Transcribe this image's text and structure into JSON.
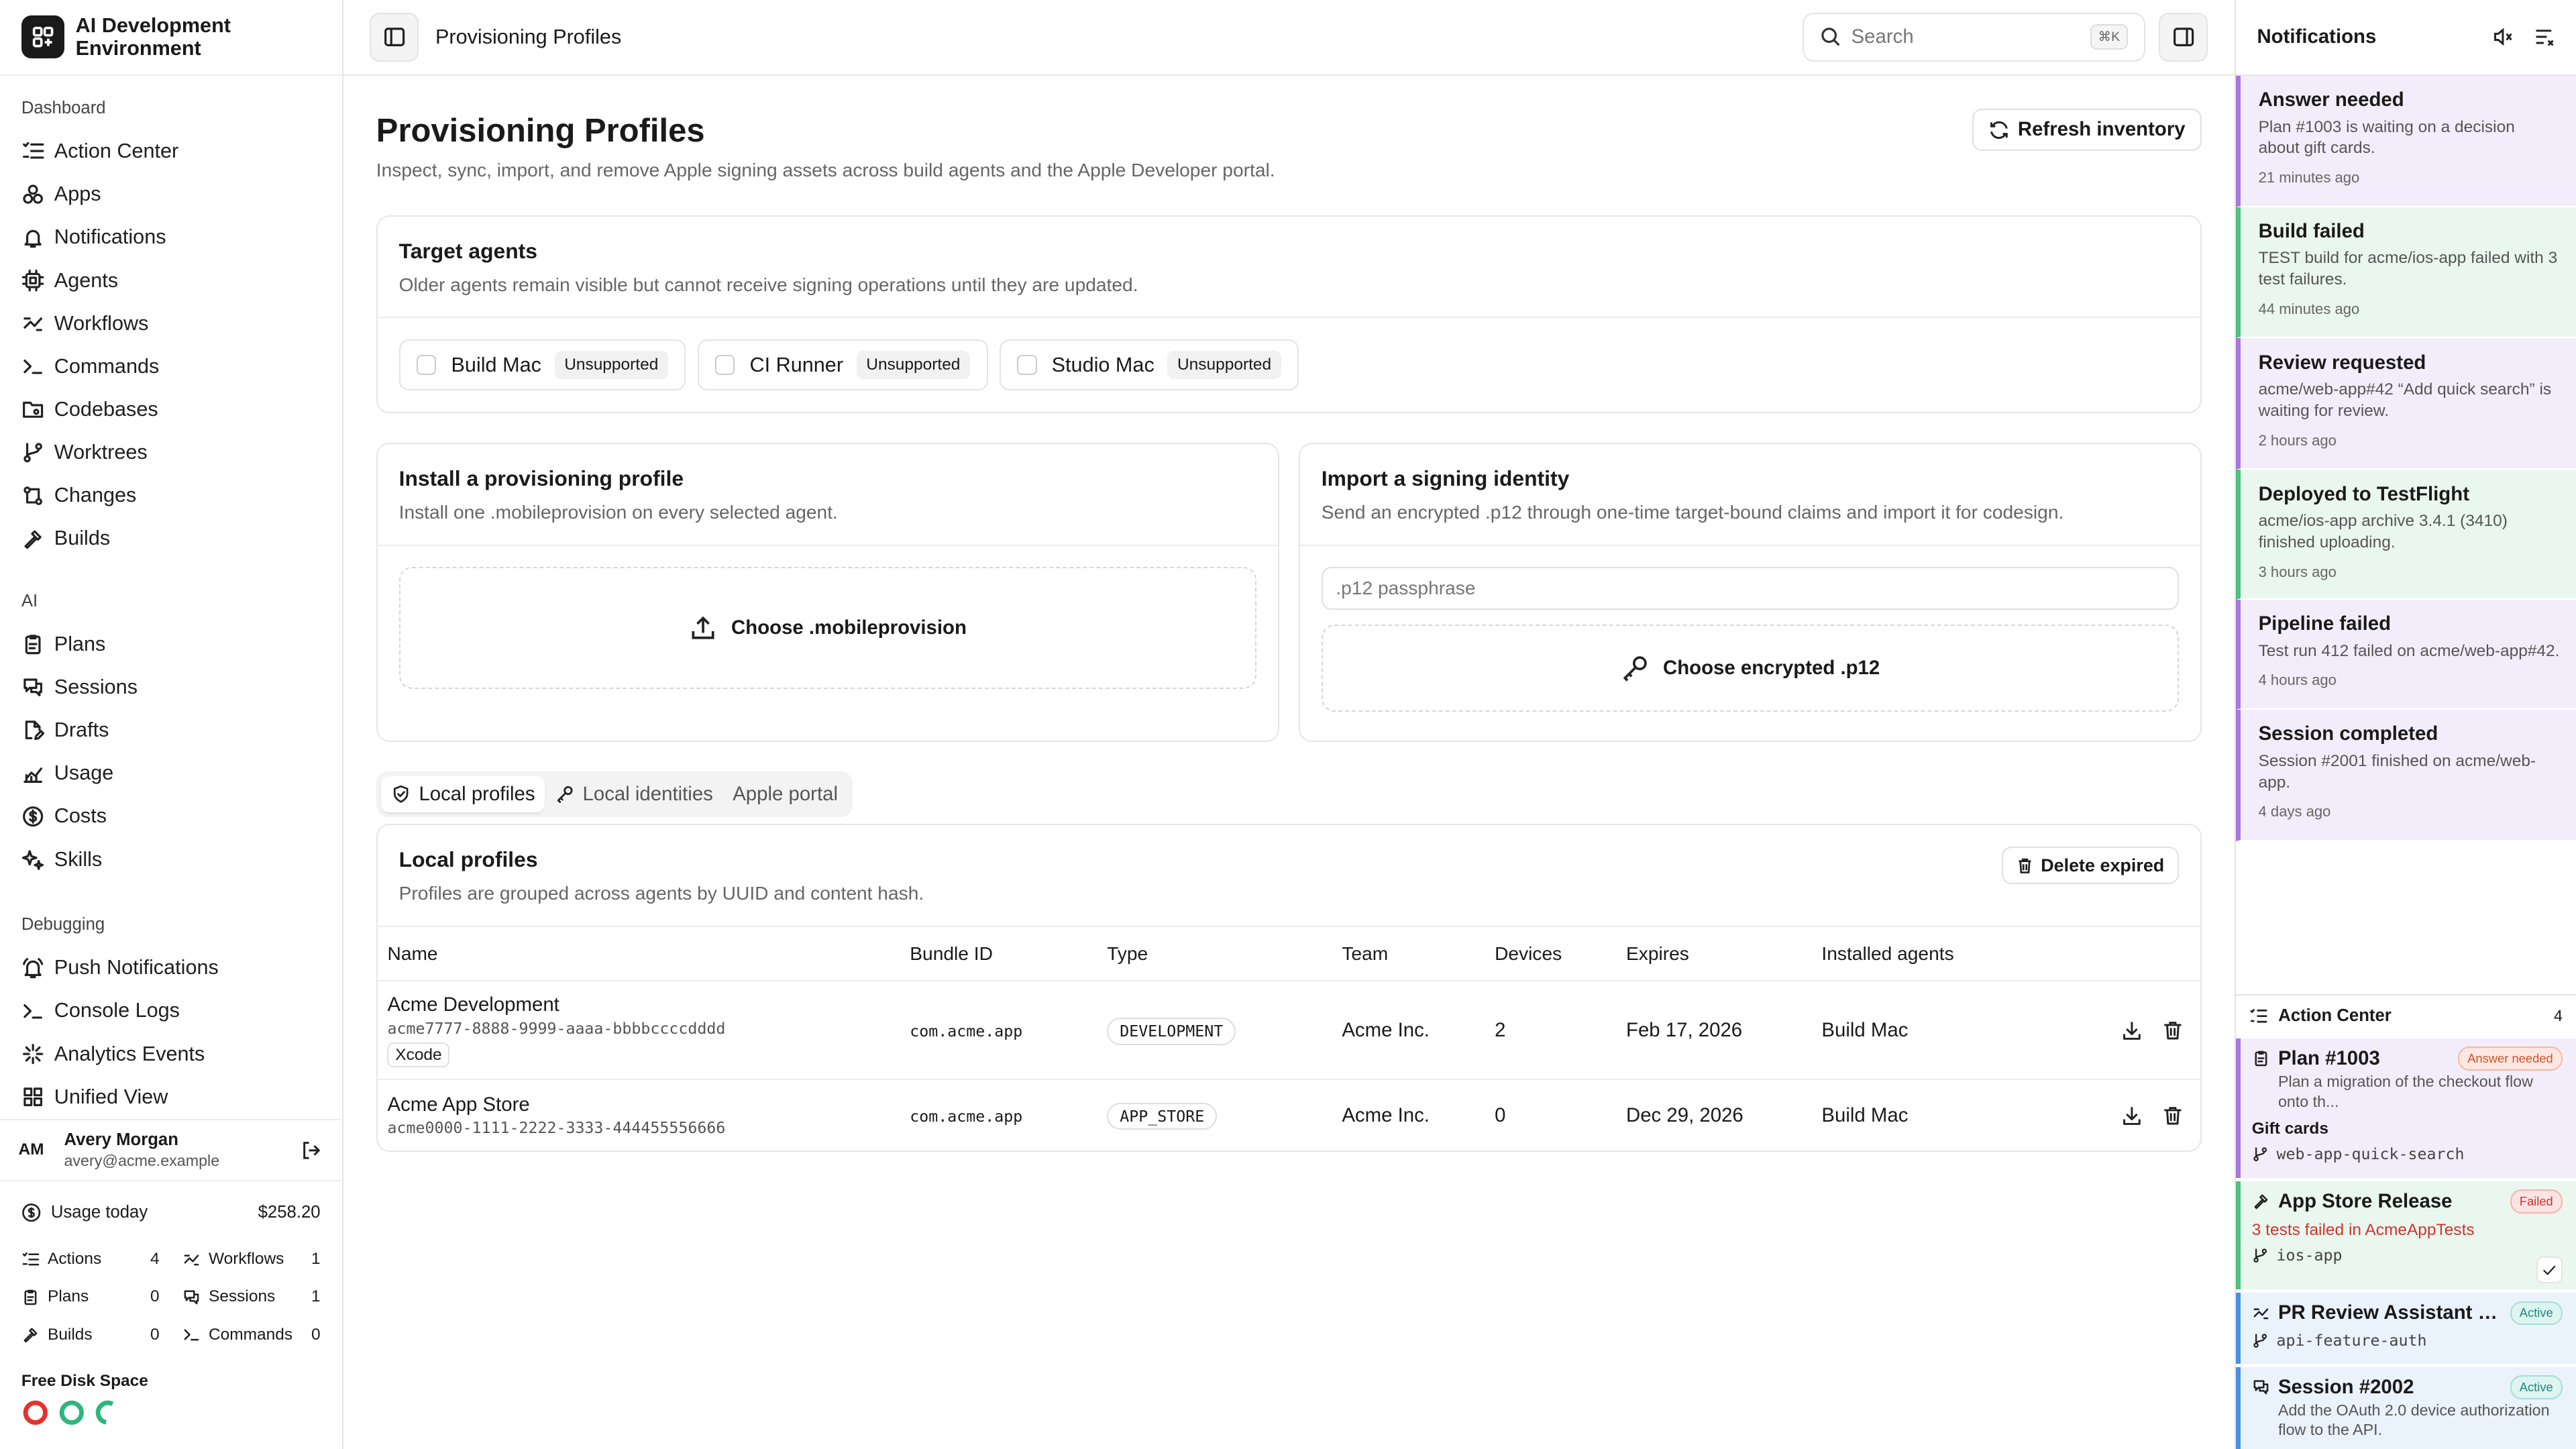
{
  "app": {
    "name": "AI Development Environment"
  },
  "sidebar": {
    "sections": [
      {
        "label": "Dashboard",
        "items": [
          {
            "label": "Action Center",
            "icon": "list-check-icon"
          },
          {
            "label": "Apps",
            "icon": "apps-icon"
          },
          {
            "label": "Notifications",
            "icon": "bell-icon"
          },
          {
            "label": "Agents",
            "icon": "cpu-icon"
          },
          {
            "label": "Workflows",
            "icon": "workflow-icon"
          },
          {
            "label": "Commands",
            "icon": "terminal-icon"
          },
          {
            "label": "Codebases",
            "icon": "folder-git-icon"
          },
          {
            "label": "Worktrees",
            "icon": "git-branch-icon"
          },
          {
            "label": "Changes",
            "icon": "git-compare-icon"
          },
          {
            "label": "Builds",
            "icon": "hammer-icon"
          }
        ]
      },
      {
        "label": "AI",
        "items": [
          {
            "label": "Plans",
            "icon": "clipboard-icon"
          },
          {
            "label": "Sessions",
            "icon": "chat-icon"
          },
          {
            "label": "Drafts",
            "icon": "file-edit-icon"
          },
          {
            "label": "Usage",
            "icon": "chart-icon"
          },
          {
            "label": "Costs",
            "icon": "dollar-icon"
          },
          {
            "label": "Skills",
            "icon": "sparkles-icon"
          }
        ]
      },
      {
        "label": "Debugging",
        "items": [
          {
            "label": "Push Notifications",
            "icon": "bell-ring-icon"
          },
          {
            "label": "Console Logs",
            "icon": "terminal-icon"
          },
          {
            "label": "Analytics Events",
            "icon": "sparkle-icon"
          },
          {
            "label": "Unified View",
            "icon": "layout-icon"
          }
        ]
      }
    ],
    "user": {
      "initials": "AM",
      "name": "Avery Morgan",
      "email": "avery@acme.example"
    },
    "usage": {
      "label": "Usage today",
      "amount": "$258.20",
      "stats": [
        {
          "label": "Actions",
          "value": "4"
        },
        {
          "label": "Workflows",
          "value": "1"
        },
        {
          "label": "Plans",
          "value": "0"
        },
        {
          "label": "Sessions",
          "value": "1"
        },
        {
          "label": "Builds",
          "value": "0"
        },
        {
          "label": "Commands",
          "value": "0"
        }
      ]
    },
    "disk": {
      "label": "Free Disk Space",
      "rings": [
        {
          "fraction": 0.05,
          "color": "#e5322d"
        },
        {
          "fraction": 0.9,
          "color": "#2fb67c"
        },
        {
          "fraction": 0.6,
          "color": "#2fb67c"
        }
      ]
    }
  },
  "topbar": {
    "breadcrumb": "Provisioning Profiles",
    "search_placeholder": "Search",
    "search_shortcut": "⌘K"
  },
  "page": {
    "title": "Provisioning Profiles",
    "subtitle": "Inspect, sync, import, and remove Apple signing assets across build agents and the Apple Developer portal.",
    "refresh_label": "Refresh inventory"
  },
  "target_agents": {
    "title": "Target agents",
    "desc": "Older agents remain visible but cannot receive signing operations until they are updated.",
    "agents": [
      {
        "name": "Build Mac",
        "status": "Unsupported"
      },
      {
        "name": "CI Runner",
        "status": "Unsupported"
      },
      {
        "name": "Studio Mac",
        "status": "Unsupported"
      }
    ]
  },
  "install_profile": {
    "title": "Install a provisioning profile",
    "desc": "Install one .mobileprovision on every selected agent.",
    "button": "Choose .mobileprovision"
  },
  "import_identity": {
    "title": "Import a signing identity",
    "desc": "Send an encrypted .p12 through one-time target-bound claims and import it for codesign.",
    "passphrase_placeholder": ".p12 passphrase",
    "button": "Choose encrypted .p12"
  },
  "tabs": [
    {
      "label": "Local profiles",
      "active": true
    },
    {
      "label": "Local identities",
      "active": false
    },
    {
      "label": "Apple portal",
      "active": false
    }
  ],
  "local_profiles": {
    "title": "Local profiles",
    "desc": "Profiles are grouped across agents by UUID and content hash.",
    "delete_label": "Delete expired",
    "columns": [
      "Name",
      "Bundle ID",
      "Type",
      "Team",
      "Devices",
      "Expires",
      "Installed agents"
    ],
    "rows": [
      {
        "name": "Acme Development",
        "uuid": "acme7777-8888-9999-aaaa-bbbbccccdddd",
        "tag": "Xcode",
        "bundle": "com.acme.app",
        "type": "DEVELOPMENT",
        "team": "Acme Inc.",
        "devices": "2",
        "expires": "Feb 17, 2026",
        "agents": "Build Mac"
      },
      {
        "name": "Acme App Store",
        "uuid": "acme0000-1111-2222-3333-444455556666",
        "tag": "",
        "bundle": "com.acme.app",
        "type": "APP_STORE",
        "team": "Acme Inc.",
        "devices": "0",
        "expires": "Dec 29, 2026",
        "agents": "Build Mac"
      }
    ]
  },
  "notifications": {
    "title": "Notifications",
    "items": [
      {
        "title": "Answer needed",
        "body": "Plan #1003 is waiting on a decision about gift cards.",
        "time": "21 minutes ago",
        "bg": "#f3edfb",
        "border": "#a779dc"
      },
      {
        "title": "Build failed",
        "body": "TEST build for acme/ios-app failed with 3 test failures.",
        "time": "44 minutes ago",
        "bg": "#eaf7ee",
        "border": "#4cc27a"
      },
      {
        "title": "Review requested",
        "body": "acme/web-app#42 “Add quick search” is waiting for review.",
        "time": "2 hours ago",
        "bg": "#f3edfb",
        "border": "#a779dc"
      },
      {
        "title": "Deployed to TestFlight",
        "body": "acme/ios-app archive 3.4.1 (3410) finished uploading.",
        "time": "3 hours ago",
        "bg": "#eaf7ee",
        "border": "#4cc27a"
      },
      {
        "title": "Pipeline failed",
        "body": "Test run 412 failed on acme/web-app#42.",
        "time": "4 hours ago",
        "bg": "#f3edfb",
        "border": "#a779dc"
      },
      {
        "title": "Session completed",
        "body": "Session #2001 finished on acme/web-app.",
        "time": "4 days ago",
        "bg": "#f3edfb",
        "border": "#a779dc"
      }
    ]
  },
  "action_center": {
    "title": "Action Center",
    "count": "4",
    "items": [
      {
        "title": "Plan #1003",
        "badge": "Answer needed",
        "desc": "Plan a migration of the checkout flow onto th...",
        "extra": "Gift cards",
        "branch": "web-app-quick-search"
      },
      {
        "title": "App Store Release",
        "badge": "Failed",
        "desc": "3 tests failed in AcmeAppTests",
        "branch": "ios-app"
      },
      {
        "title": "PR Review Assistant #4...",
        "badge": "Active",
        "branch": "api-feature-auth"
      },
      {
        "title": "Session #2002",
        "badge": "Active",
        "desc": "Add the OAuth 2.0 device authorization flow to the API."
      }
    ]
  }
}
